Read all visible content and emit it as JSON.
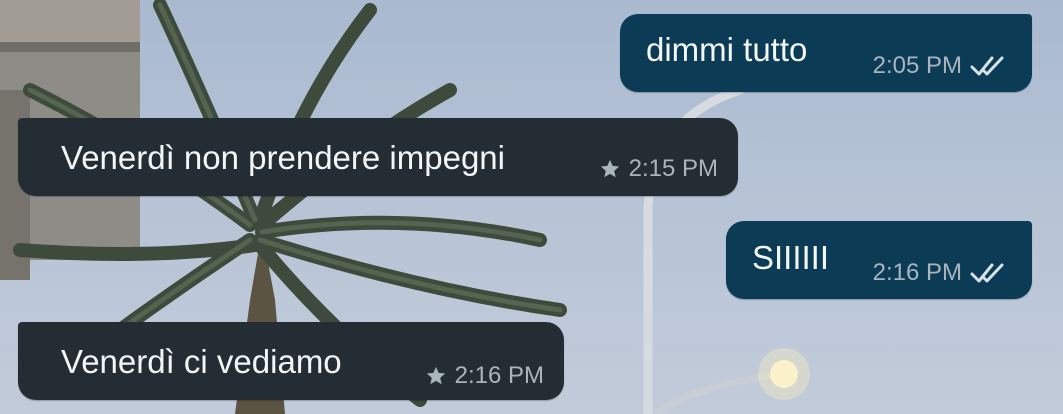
{
  "messages": [
    {
      "text": "dimmi tutto",
      "time": "2:05 PM",
      "direction": "outgoing",
      "status_icon": "double-check-icon"
    },
    {
      "text": "Venerdì non prendere impegni",
      "time": "2:15 PM",
      "direction": "incoming",
      "starred": true
    },
    {
      "text": "SIIIIII",
      "time": "2:16 PM",
      "direction": "outgoing",
      "status_icon": "double-check-icon"
    },
    {
      "text": "Venerdì ci vediamo",
      "time": "2:16 PM",
      "direction": "incoming",
      "starred": true
    }
  ],
  "colors": {
    "outgoing_bubble": "#0c3b55",
    "incoming_bubble": "#242d33",
    "meta_text": "#a9b5bc",
    "sky": "#b6c3d6"
  },
  "wallpaper": {
    "subject": "palm tree and street lamp against evening sky"
  }
}
